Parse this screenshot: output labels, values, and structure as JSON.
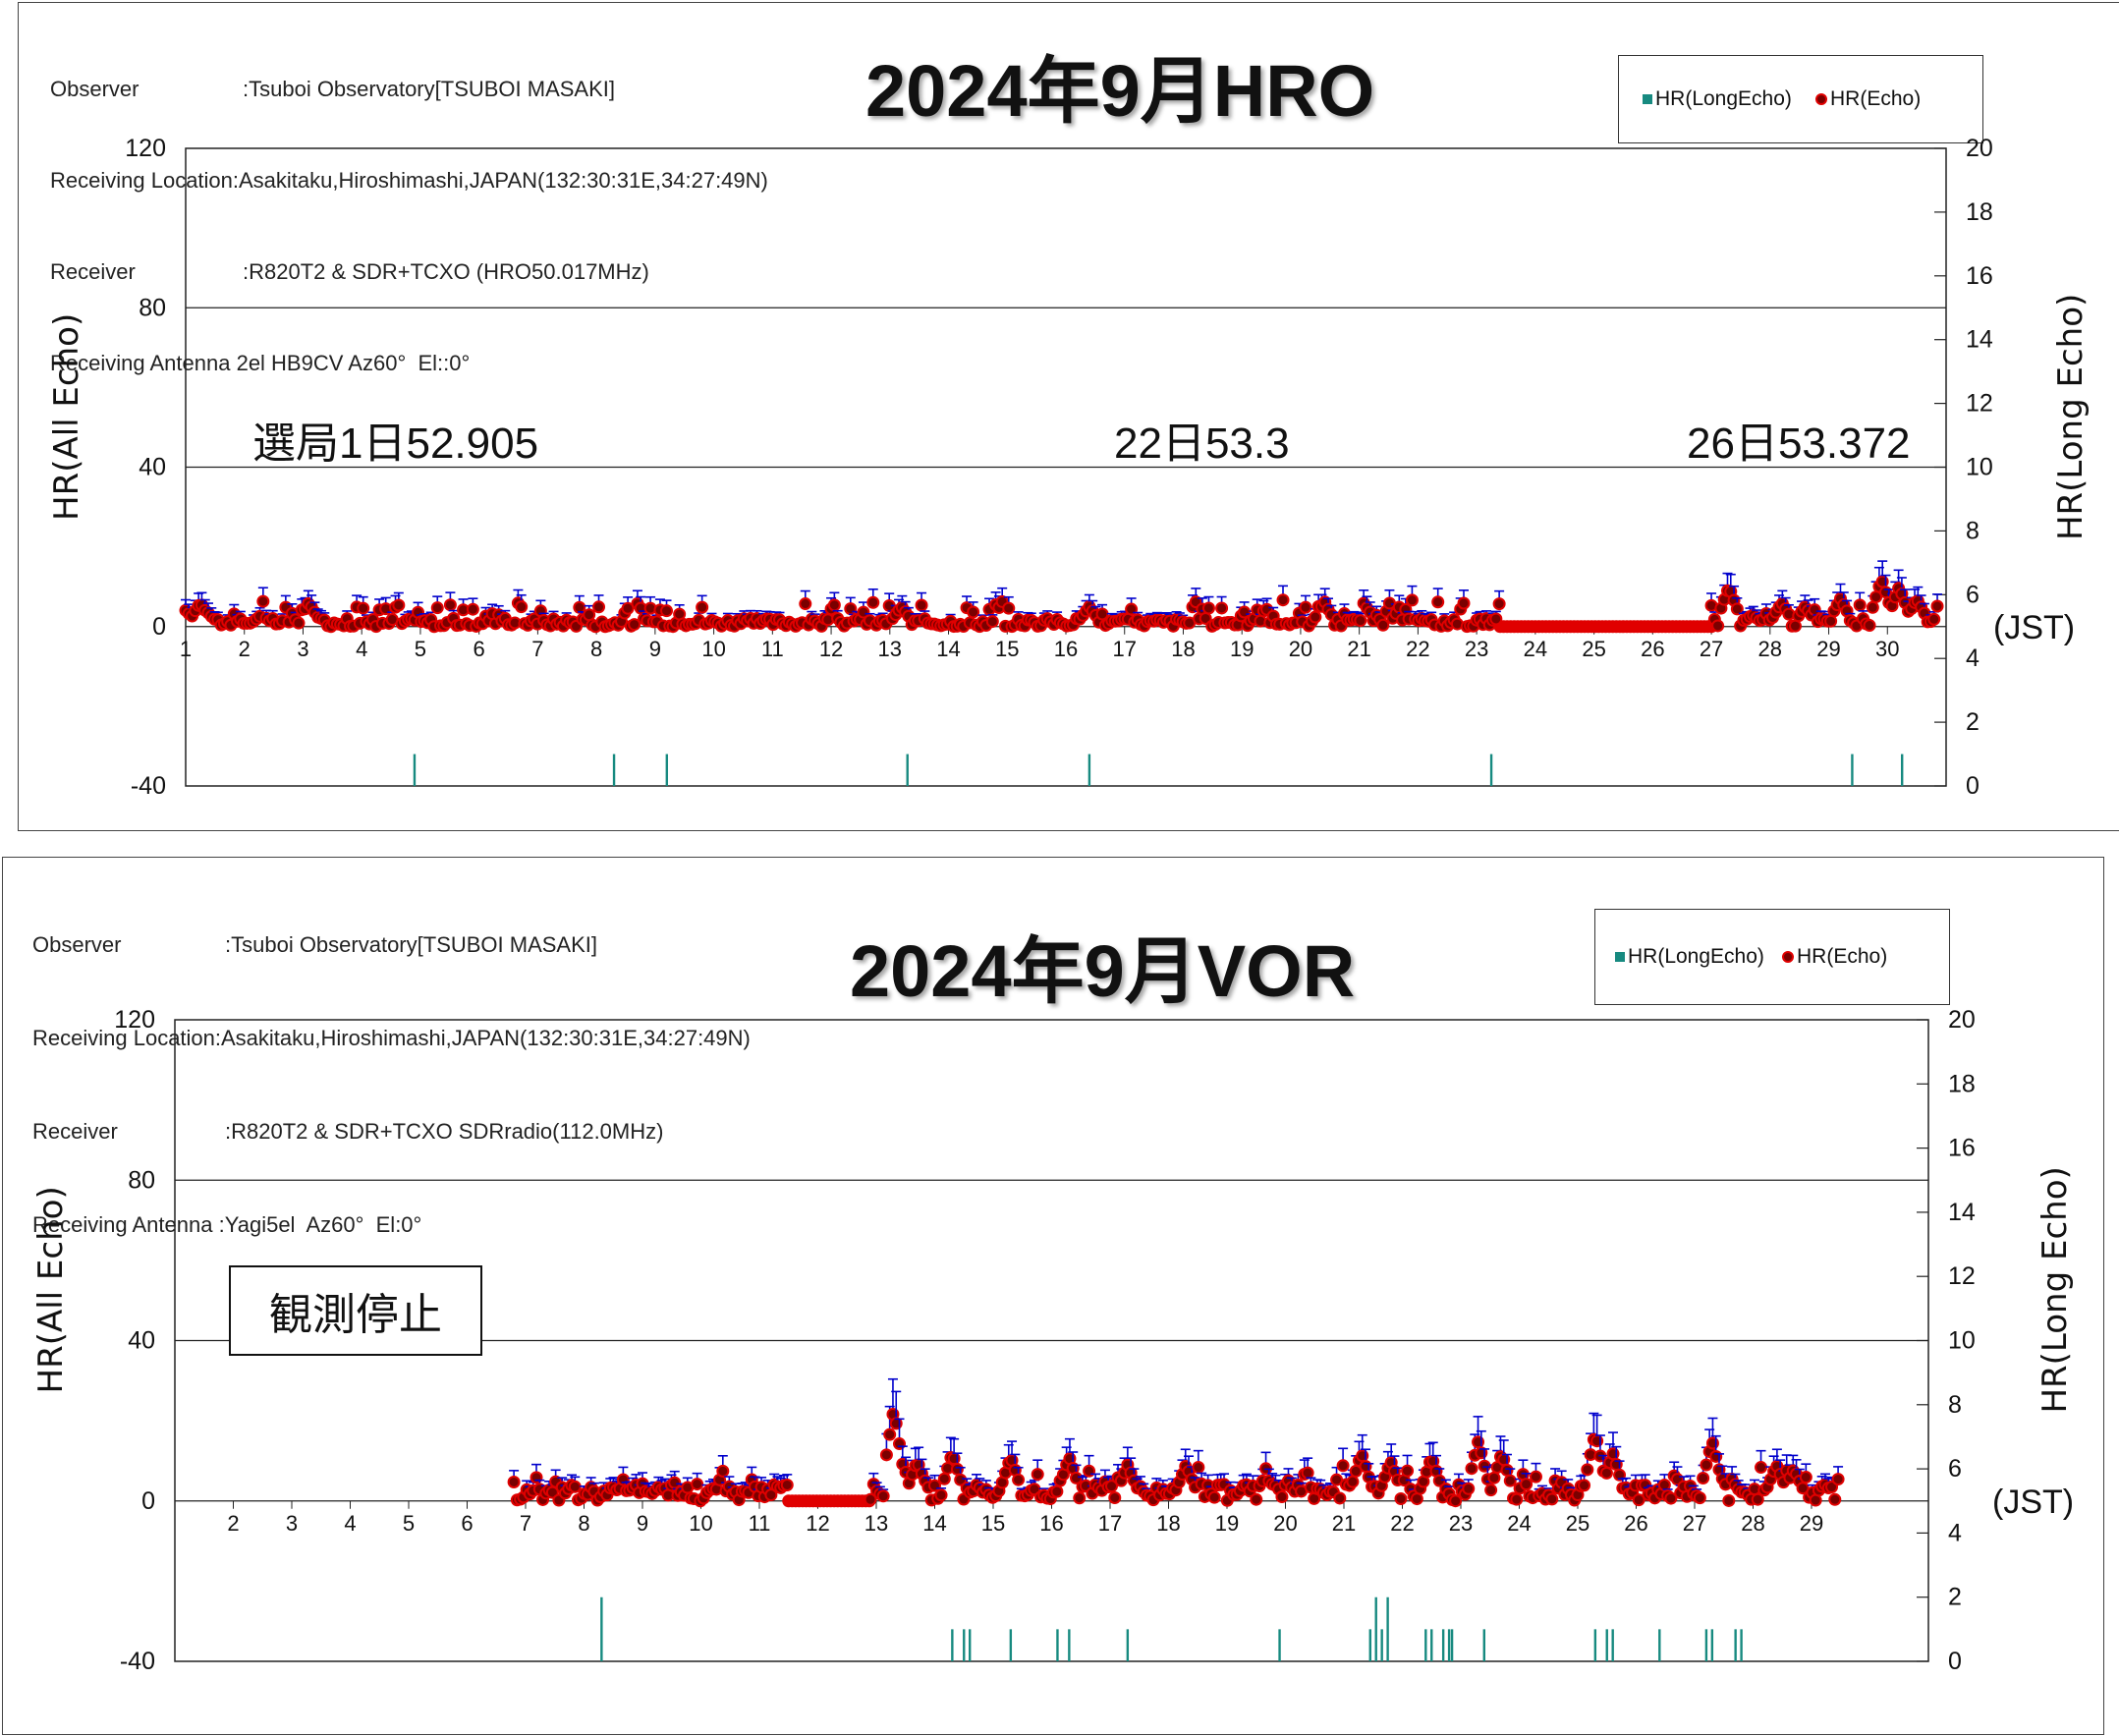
{
  "colors": {
    "echo_fill": "#7a0000",
    "echo_stroke": "#e00000",
    "error_bar": "#0000cc",
    "long_echo": "#178a80",
    "grid": "#222222"
  },
  "chart_data": [
    {
      "type": "scatter",
      "title": "2024年9月HRO",
      "meta": {
        "observer_label": "Observer",
        "observer_value": ":Tsuboi Observatory[TSUBOI MASAKI]",
        "location": "Receiving Location:Asakitaku,Hiroshimashi,JAPAN(132:30:31E,34:27:49N)",
        "receiver_label": "Receiver",
        "receiver_value": ":R820T2 & SDR+TCXO (HRO50.017MHz)",
        "antenna": "Receiving Antenna 2el HB9CV Az60°  El::0°"
      },
      "legend": [
        "HR(LongEcho)",
        "HR(Echo)"
      ],
      "legend_position": "top-right",
      "ylabel": "HR(All Echo)",
      "y2label": "HR(Long Echo)",
      "x_unit_label": "(JST)",
      "ylim": [
        -40,
        120
      ],
      "yticks": [
        -40,
        0,
        40,
        80,
        120
      ],
      "y2lim": [
        0,
        20
      ],
      "y2ticks": [
        0,
        2,
        4,
        6,
        8,
        10,
        12,
        14,
        16,
        18,
        20
      ],
      "xlim": [
        1,
        31
      ],
      "xticks": [
        1,
        2,
        3,
        4,
        5,
        6,
        7,
        8,
        9,
        10,
        11,
        12,
        13,
        14,
        15,
        16,
        17,
        18,
        19,
        20,
        21,
        22,
        23,
        24,
        25,
        26,
        27,
        28,
        29,
        30
      ],
      "annotations": [
        "選局1日52.905",
        "22日53.3",
        "26日53.372"
      ],
      "echo_active_ranges": [
        [
          1.0,
          23.4
        ],
        [
          27.0,
          30.9
        ]
      ],
      "echo_zero_ranges": [
        [
          23.4,
          27.0
        ]
      ],
      "echo_peaks": [
        [
          1.25,
          6
        ],
        [
          1.35,
          4
        ],
        [
          3.1,
          6
        ],
        [
          2.3,
          3
        ],
        [
          13.2,
          5
        ],
        [
          16.4,
          5
        ],
        [
          20.4,
          6
        ],
        [
          27.3,
          10
        ],
        [
          27.7,
          3
        ],
        [
          28.2,
          6
        ],
        [
          28.6,
          5
        ],
        [
          29.2,
          7
        ],
        [
          29.9,
          12
        ],
        [
          30.2,
          10
        ],
        [
          30.5,
          7
        ]
      ],
      "echo_base_level": 1.5,
      "long_echo": [
        [
          4.9,
          1
        ],
        [
          8.3,
          1
        ],
        [
          9.2,
          1
        ],
        [
          13.3,
          1
        ],
        [
          16.4,
          1
        ],
        [
          23.25,
          1
        ],
        [
          29.4,
          1
        ],
        [
          30.25,
          1
        ]
      ]
    },
    {
      "type": "scatter",
      "title": "2024年9月VOR",
      "meta": {
        "observer_label": "Observer",
        "observer_value": ":Tsuboi Observatory[TSUBOI MASAKI]",
        "location": "Receiving Location:Asakitaku,Hiroshimashi,JAPAN(132:30:31E,34:27:49N)",
        "receiver_label": "Receiver",
        "receiver_value": ":R820T2 & SDR+TCXO SDRradio(112.0MHz)",
        "antenna": "Receiving Antenna :Yagi5el  Az60°  El:0°"
      },
      "legend": [
        "HR(LongEcho)",
        "HR(Echo)"
      ],
      "legend_position": "top-right",
      "ylabel": "HR(All Echo)",
      "y2label": "HR(Long Echo)",
      "x_unit_label": "(JST)",
      "ylim": [
        -40,
        120
      ],
      "yticks": [
        -40,
        0,
        40,
        80,
        120
      ],
      "y2lim": [
        0,
        20
      ],
      "y2ticks": [
        0,
        2,
        4,
        6,
        8,
        10,
        12,
        14,
        16,
        18,
        20
      ],
      "xlim": [
        1,
        31
      ],
      "xticks": [
        2,
        3,
        4,
        5,
        6,
        7,
        8,
        9,
        10,
        11,
        12,
        13,
        14,
        15,
        16,
        17,
        18,
        19,
        20,
        21,
        22,
        23,
        24,
        25,
        26,
        27,
        28,
        29
      ],
      "annotations": [
        "観測停止"
      ],
      "echo_active_ranges": [
        [
          6.8,
          11.5
        ],
        [
          12.9,
          29.5
        ]
      ],
      "echo_zero_ranges": [
        [
          11.5,
          12.9
        ]
      ],
      "echo_peaks": [
        [
          13.3,
          23
        ],
        [
          13.7,
          10
        ],
        [
          14.3,
          12
        ],
        [
          15.3,
          11
        ],
        [
          16.3,
          11
        ],
        [
          17.3,
          9
        ],
        [
          18.3,
          9
        ],
        [
          21.3,
          12
        ],
        [
          21.8,
          10
        ],
        [
          22.5,
          11
        ],
        [
          23.3,
          15
        ],
        [
          23.7,
          12
        ],
        [
          25.3,
          17
        ],
        [
          25.6,
          12
        ],
        [
          27.3,
          15
        ],
        [
          28.4,
          9
        ],
        [
          28.7,
          8
        ]
      ],
      "echo_base_level": 3,
      "long_echo": [
        [
          8.3,
          2
        ],
        [
          14.3,
          1
        ],
        [
          14.5,
          1
        ],
        [
          14.6,
          1
        ],
        [
          15.3,
          1
        ],
        [
          16.1,
          1
        ],
        [
          16.3,
          1
        ],
        [
          17.3,
          1
        ],
        [
          19.9,
          1
        ],
        [
          21.45,
          1
        ],
        [
          21.55,
          2
        ],
        [
          21.65,
          1
        ],
        [
          21.75,
          2
        ],
        [
          22.4,
          1
        ],
        [
          22.5,
          1
        ],
        [
          22.7,
          1
        ],
        [
          22.8,
          1
        ],
        [
          22.85,
          1
        ],
        [
          23.4,
          1
        ],
        [
          25.3,
          1
        ],
        [
          25.5,
          1
        ],
        [
          25.6,
          1
        ],
        [
          26.4,
          1
        ],
        [
          27.2,
          1
        ],
        [
          27.3,
          1
        ],
        [
          27.7,
          1
        ],
        [
          27.8,
          1
        ]
      ]
    }
  ]
}
